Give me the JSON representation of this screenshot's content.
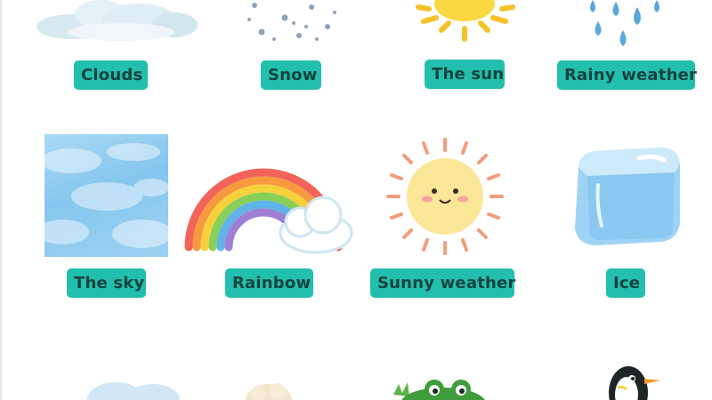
{
  "cards": {
    "clouds": "Clouds",
    "snow": "Snow",
    "sun": "The sun",
    "rainy": "Rainy weather",
    "sky": "The sky",
    "rainbow": "Rainbow",
    "sunny": "Sunny weather",
    "ice": "Ice"
  },
  "icons": [
    "clouds-picture",
    "snow-picture",
    "sun-picture",
    "raindrops-picture",
    "sky-picture",
    "rainbow-picture",
    "sunny-face-picture",
    "ice-cube-picture",
    "cloud-picture",
    "sheep-picture",
    "frog-picture",
    "penguin-picture"
  ],
  "colors": {
    "label_bg": "#22bfae",
    "label_text": "#17433f"
  }
}
